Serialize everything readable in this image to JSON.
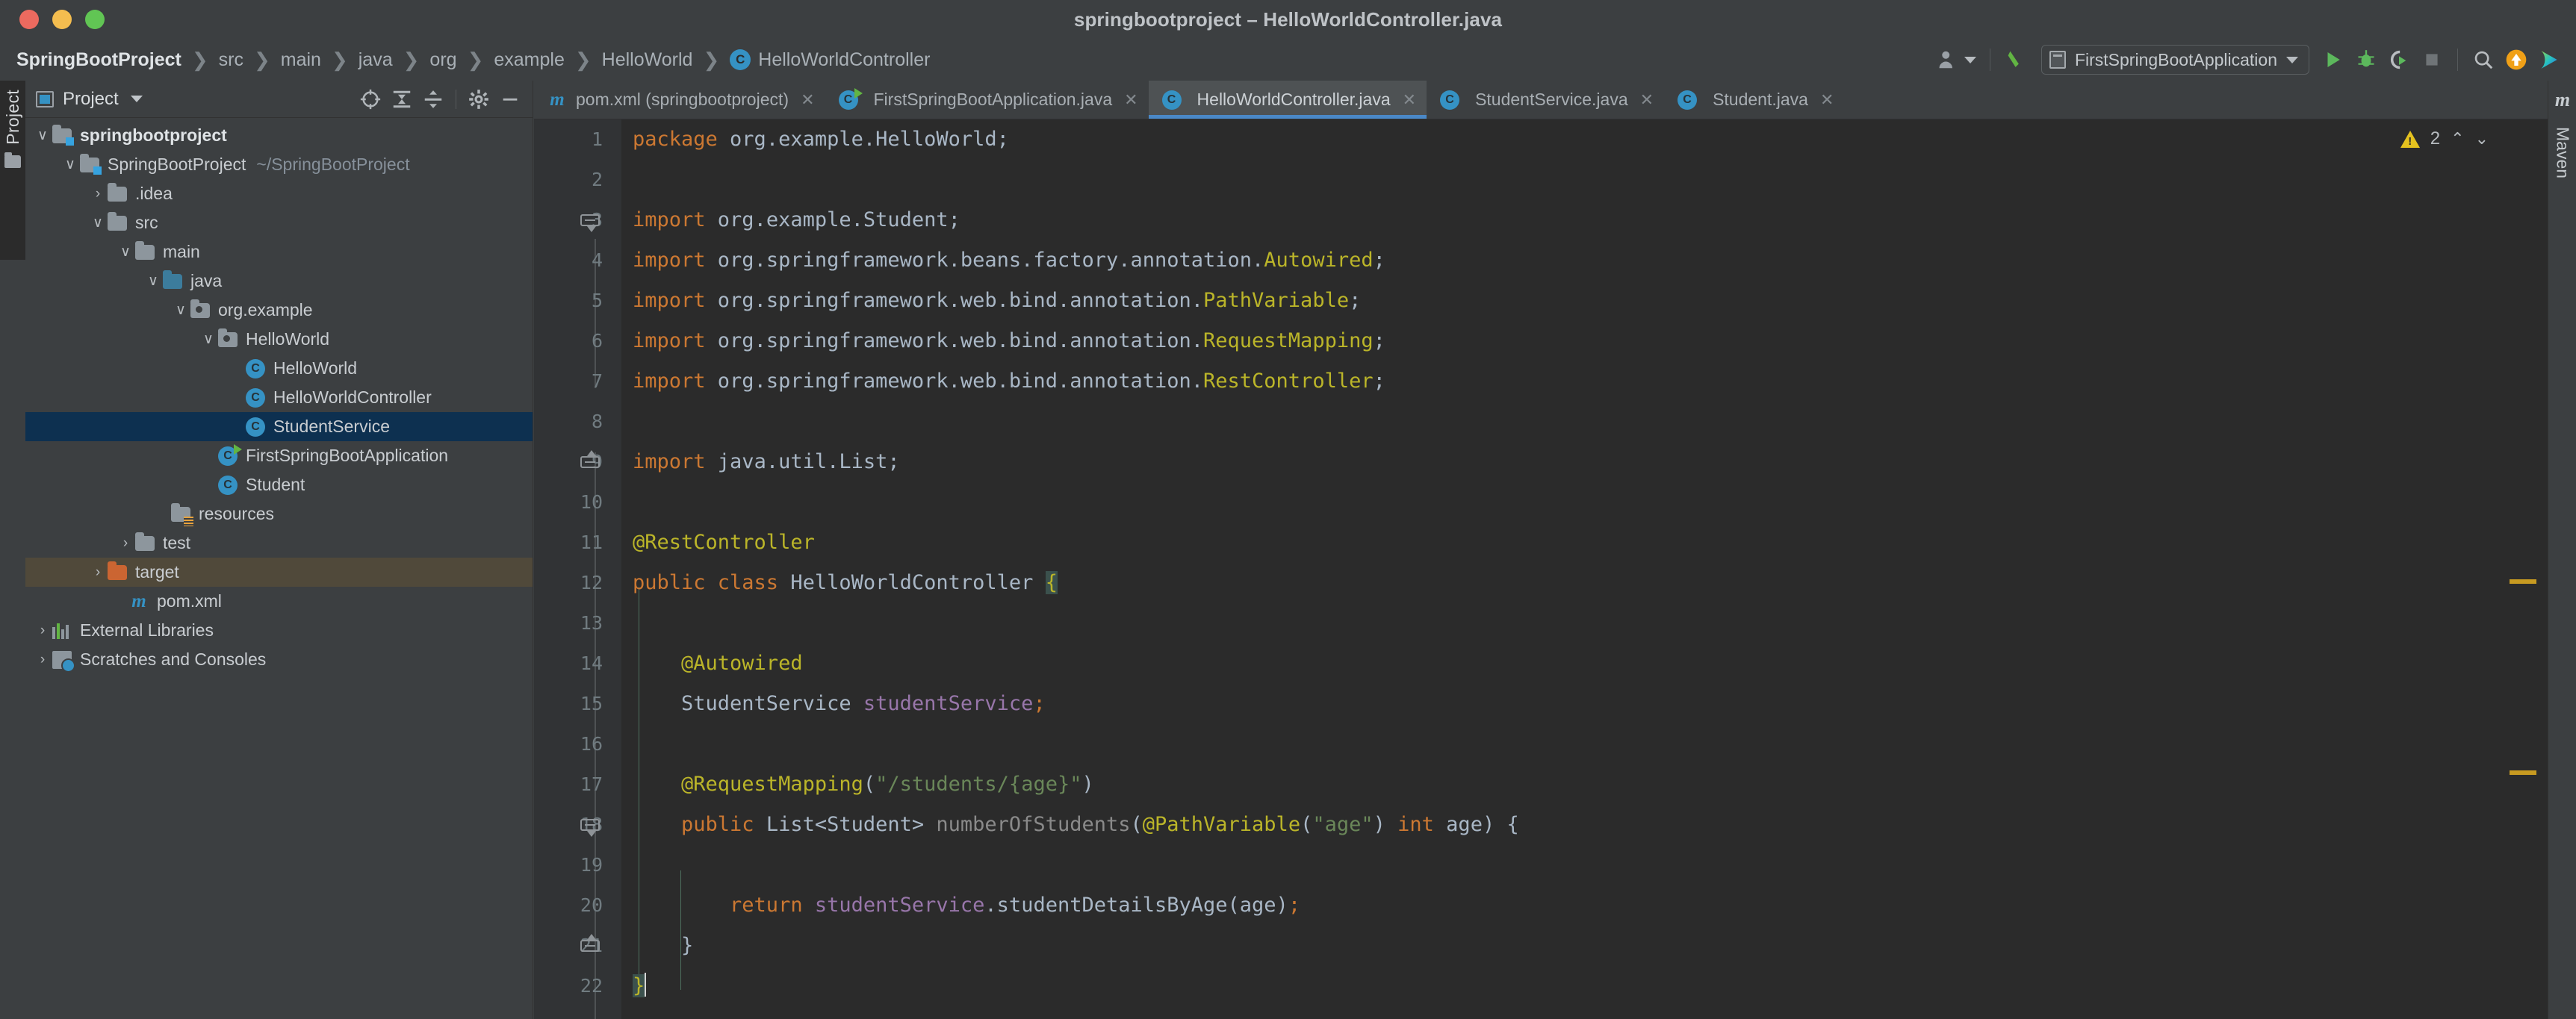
{
  "window": {
    "title": "springbootproject – HelloWorldController.java",
    "traffic_lights": [
      "close",
      "minimize",
      "maximize"
    ]
  },
  "breadcrumb": {
    "items": [
      {
        "label": "SpringBootProject",
        "icon": ""
      },
      {
        "label": "src",
        "icon": ""
      },
      {
        "label": "main",
        "icon": ""
      },
      {
        "label": "java",
        "icon": ""
      },
      {
        "label": "org",
        "icon": ""
      },
      {
        "label": "example",
        "icon": ""
      },
      {
        "label": "HelloWorld",
        "icon": ""
      },
      {
        "label": "HelloWorldController",
        "icon": "class-badge"
      }
    ],
    "separator": "❯"
  },
  "navbar_right": {
    "account_icon": "user-icon",
    "build_icon": "hammer-icon",
    "run_config": "FirstSpringBootApplication",
    "run_icon": "run-icon",
    "debug_icon": "debug-icon",
    "run_coverage_icon": "run-with-coverage-icon",
    "stop_icon": "stop-icon",
    "search_icon": "search-icon",
    "update_icon": "update-arrow-icon",
    "ide_icon": "ide-feature-icon"
  },
  "left_strip": {
    "project_tab": "Project"
  },
  "project_panel": {
    "title": "Project",
    "tools": [
      "locate-icon",
      "expand-all-icon",
      "collapse-all-icon",
      "settings-icon",
      "hide-icon"
    ],
    "tree": [
      {
        "label": "springbootproject",
        "indent": 0,
        "arrow": "∨",
        "icon": "module-folder",
        "bold": true,
        "path": ""
      },
      {
        "label": "SpringBootProject",
        "indent": 1,
        "arrow": "∨",
        "icon": "module-folder",
        "bold": false,
        "path": "~/SpringBootProject"
      },
      {
        "label": ".idea",
        "indent": 2,
        "arrow": "›",
        "icon": "folder",
        "bold": false,
        "path": ""
      },
      {
        "label": "src",
        "indent": 2,
        "arrow": "∨",
        "icon": "folder",
        "bold": false,
        "path": ""
      },
      {
        "label": "main",
        "indent": 3,
        "arrow": "∨",
        "icon": "folder",
        "bold": false,
        "path": ""
      },
      {
        "label": "java",
        "indent": 4,
        "arrow": "∨",
        "icon": "source-folder",
        "bold": false,
        "path": ""
      },
      {
        "label": "org.example",
        "indent": 5,
        "arrow": "∨",
        "icon": "package",
        "bold": false,
        "path": ""
      },
      {
        "label": "HelloWorld",
        "indent": 6,
        "arrow": "∨",
        "icon": "package",
        "bold": false,
        "path": ""
      },
      {
        "label": "HelloWorld",
        "indent": 7,
        "arrow": "",
        "icon": "java-class",
        "bold": false,
        "path": ""
      },
      {
        "label": "HelloWorldController",
        "indent": 7,
        "arrow": "",
        "icon": "java-class",
        "bold": false,
        "path": ""
      },
      {
        "label": "StudentService",
        "indent": 7,
        "arrow": "",
        "icon": "java-class",
        "bold": false,
        "path": "",
        "selected": true
      },
      {
        "label": "FirstSpringBootApplication",
        "indent": 6,
        "arrow": "",
        "icon": "java-class-runnable",
        "bold": false,
        "path": ""
      },
      {
        "label": "Student",
        "indent": 6,
        "arrow": "",
        "icon": "java-class",
        "bold": false,
        "path": ""
      },
      {
        "label": "resources",
        "indent": 5,
        "arrow": "",
        "icon": "resources-folder",
        "bold": false,
        "path": ""
      },
      {
        "label": "test",
        "indent": 4,
        "arrow": "›",
        "icon": "folder",
        "bold": false,
        "path": ""
      },
      {
        "label": "target",
        "indent": 3,
        "arrow": "›",
        "icon": "excluded-folder",
        "bold": false,
        "path": "",
        "highlighted": true
      },
      {
        "label": "pom.xml",
        "indent": 4,
        "arrow": "",
        "icon": "maven-file",
        "bold": false,
        "path": ""
      },
      {
        "label": "External Libraries",
        "indent": 1,
        "arrow": "›",
        "icon": "libraries",
        "bold": false,
        "path": ""
      },
      {
        "label": "Scratches and Consoles",
        "indent": 1,
        "arrow": "›",
        "icon": "scratches",
        "bold": false,
        "path": ""
      }
    ]
  },
  "editor_tabs": {
    "tabs": [
      {
        "label": "pom.xml (springbootproject)",
        "icon": "maven-file",
        "active": false,
        "close": "✕"
      },
      {
        "label": "FirstSpringBootApplication.java",
        "icon": "java-class-runnable",
        "active": false,
        "close": "✕"
      },
      {
        "label": "HelloWorldController.java",
        "icon": "java-class",
        "active": true,
        "close": "✕"
      },
      {
        "label": "StudentService.java",
        "icon": "java-class",
        "active": false,
        "close": "✕"
      },
      {
        "label": "Student.java",
        "icon": "java-class",
        "active": false,
        "close": "✕"
      }
    ],
    "overflow_icon": "more-options-icon"
  },
  "inspections": {
    "warning_icon": "warning-icon",
    "warning_count": "2",
    "prev_icon": "⌃",
    "next_icon": "⌄",
    "markers": [
      {
        "top": 0.51
      },
      {
        "top": 0.73
      }
    ]
  },
  "right_strip": {
    "maven_letter": "m",
    "maven_label": "Maven"
  },
  "code": {
    "language": "java",
    "lines": [
      {
        "n": "1",
        "tokens": [
          {
            "t": "package ",
            "c": "kw"
          },
          {
            "t": "org.example.HelloWorld;",
            "c": "dim"
          }
        ]
      },
      {
        "n": "2",
        "tokens": []
      },
      {
        "n": "3",
        "tokens": [
          {
            "t": "import ",
            "c": "kw"
          },
          {
            "t": "org.example.Student;",
            "c": "dim"
          }
        ],
        "fold": "down"
      },
      {
        "n": "4",
        "tokens": [
          {
            "t": "import ",
            "c": "kw"
          },
          {
            "t": "org.springframework.beans.factory.annotation.",
            "c": "dim"
          },
          {
            "t": "Autowired",
            "c": "anno"
          },
          {
            "t": ";",
            "c": "dim"
          }
        ]
      },
      {
        "n": "5",
        "tokens": [
          {
            "t": "import ",
            "c": "kw"
          },
          {
            "t": "org.springframework.web.bind.annotation.",
            "c": "dim"
          },
          {
            "t": "PathVariable",
            "c": "anno"
          },
          {
            "t": ";",
            "c": "dim"
          }
        ]
      },
      {
        "n": "6",
        "tokens": [
          {
            "t": "import ",
            "c": "kw"
          },
          {
            "t": "org.springframework.web.bind.annotation.",
            "c": "dim"
          },
          {
            "t": "RequestMapping",
            "c": "anno"
          },
          {
            "t": ";",
            "c": "dim"
          }
        ]
      },
      {
        "n": "7",
        "tokens": [
          {
            "t": "import ",
            "c": "kw"
          },
          {
            "t": "org.springframework.web.bind.annotation.",
            "c": "dim"
          },
          {
            "t": "RestController",
            "c": "anno"
          },
          {
            "t": ";",
            "c": "dim"
          }
        ]
      },
      {
        "n": "8",
        "tokens": []
      },
      {
        "n": "9",
        "tokens": [
          {
            "t": "import ",
            "c": "kw"
          },
          {
            "t": "java.util.List;",
            "c": "dim"
          }
        ],
        "fold": "up"
      },
      {
        "n": "10",
        "tokens": []
      },
      {
        "n": "11",
        "tokens": [
          {
            "t": "@RestController",
            "c": "anno"
          }
        ]
      },
      {
        "n": "12",
        "tokens": [
          {
            "t": "public class ",
            "c": "kw"
          },
          {
            "t": "HelloWorldController ",
            "c": "dim"
          },
          {
            "t": "{",
            "c": "anno brace-hl"
          }
        ]
      },
      {
        "n": "13",
        "tokens": []
      },
      {
        "n": "14",
        "tokens": [
          {
            "t": "    @Autowired",
            "c": "anno"
          }
        ]
      },
      {
        "n": "15",
        "tokens": [
          {
            "t": "    StudentService ",
            "c": "dim"
          },
          {
            "t": "studentService",
            "c": "fld"
          },
          {
            "t": ";",
            "c": "kw"
          }
        ]
      },
      {
        "n": "16",
        "tokens": []
      },
      {
        "n": "17",
        "tokens": [
          {
            "t": "    @RequestMapping",
            "c": "anno"
          },
          {
            "t": "(",
            "c": "dim"
          },
          {
            "t": "\"/students/{age}\"",
            "c": "str"
          },
          {
            "t": ")",
            "c": "dim"
          }
        ]
      },
      {
        "n": "18",
        "tokens": [
          {
            "t": "    public ",
            "c": "kw"
          },
          {
            "t": "List<Student> ",
            "c": "dim"
          },
          {
            "t": "numberOfStudents",
            "c": "mcall"
          },
          {
            "t": "(",
            "c": "dim"
          },
          {
            "t": "@PathVariable",
            "c": "anno"
          },
          {
            "t": "(",
            "c": "dim"
          },
          {
            "t": "\"age\"",
            "c": "str"
          },
          {
            "t": ") ",
            "c": "dim"
          },
          {
            "t": "int",
            "c": "kw"
          },
          {
            "t": " age) {",
            "c": "dim"
          }
        ],
        "fold": "down"
      },
      {
        "n": "19",
        "tokens": []
      },
      {
        "n": "20",
        "tokens": [
          {
            "t": "        return ",
            "c": "kw"
          },
          {
            "t": "studentService",
            "c": "fld"
          },
          {
            "t": ".studentDetailsByAge(age)",
            "c": "dim"
          },
          {
            "t": ";",
            "c": "kw"
          }
        ]
      },
      {
        "n": "21",
        "tokens": [
          {
            "t": "    }",
            "c": "dim"
          }
        ],
        "fold": "up"
      },
      {
        "n": "22",
        "tokens": [
          {
            "t": "}",
            "c": "anno brace-hl"
          }
        ],
        "caret": true
      }
    ]
  },
  "colors": {
    "bg_chrome": "#3c3f41",
    "bg_editor": "#2b2b2b",
    "bg_gutter": "#313335",
    "accent_blue": "#4a88c7",
    "selection": "#0d3050",
    "excluded": "#50493a",
    "keyword": "#cc7832",
    "annotation": "#bbb529",
    "string": "#6a8759",
    "field": "#9876aa",
    "text": "#a9b7c6",
    "warning": "#e5c21f"
  }
}
